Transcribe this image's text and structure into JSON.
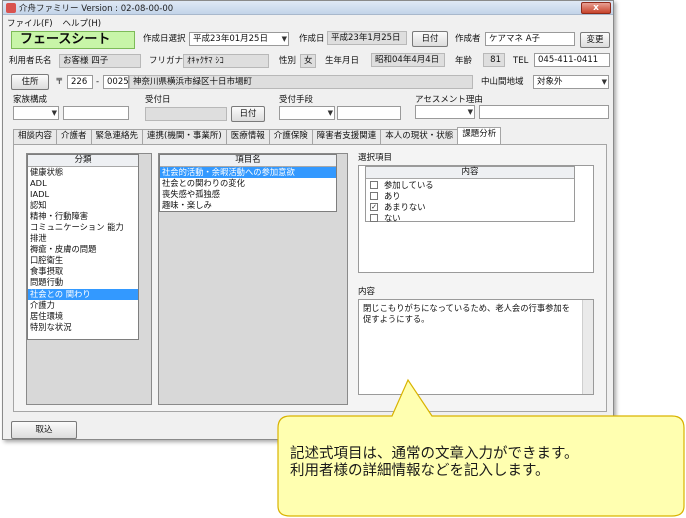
{
  "window": {
    "title": "介舟ファミリー Version : 02-08-00-00",
    "close_label": "x"
  },
  "menu": [
    "ファイル(F)",
    "ヘルプ(H)"
  ],
  "header": {
    "sheet_title": "フェースシート",
    "select_date_label": "作成日選択",
    "select_date_value": "平成23年01月25日",
    "created_label": "作成日",
    "created_value": "平成23年1月25日",
    "date_button": "日付",
    "author_label": "作成者",
    "author_value": "ケアマネ A子",
    "change_button": "変更"
  },
  "user": {
    "name_label": "利用者氏名",
    "name_value": "お客様 四子",
    "furigana_label": "フリガナ",
    "furigana_value": "ｵｷｬｸｻﾏ ｼｺ",
    "sex_label": "性別",
    "sex_value": "女",
    "birth_label": "生年月日",
    "birth_value": "昭和04年4月4日",
    "age_label": "年齢",
    "age_value": "81",
    "tel_label": "TEL",
    "tel_value": "045-411-0411"
  },
  "address": {
    "button": "住所",
    "postal_mark": "〒",
    "zip1": "226",
    "dash": "-",
    "zip2": "0025",
    "value": "神奈川県横浜市緑区十日市場町",
    "region_label": "中山間地域",
    "region_value": "対象外"
  },
  "family": {
    "label": "家族構成",
    "accept_date_label": "受付日",
    "accept_date_button": "日付",
    "accept_method_label": "受付手段",
    "assessment_label": "アセスメント理由"
  },
  "tabs": [
    "相談内容",
    "介護者",
    "緊急連絡先",
    "連携(機関・事業所)",
    "医療情報",
    "介護保険",
    "障害者支援関連",
    "本人の現状・状態",
    "課題分析"
  ],
  "active_tab": "課題分析",
  "category_list": {
    "header": "分類",
    "items": [
      "健康状態",
      "ADL",
      "IADL",
      "認知",
      "精神・行動障害",
      "コミュニケーション 能力",
      "排泄",
      "褥瘡・皮膚の問題",
      "口腔衛生",
      "食事摂取",
      "問題行動",
      "社会との 関わり",
      "介護力",
      "居住環境",
      "特別な状況"
    ],
    "selected": "社会との 関わり"
  },
  "item_list": {
    "header": "項目名",
    "items": [
      "社会的活動・余暇活動への参加意欲",
      "社会との関わりの変化",
      "喪失感や孤独感",
      "趣味・楽しみ"
    ],
    "selected": "社会的活動・余暇活動への参加意欲"
  },
  "selection": {
    "label": "選択項目",
    "header": "内容",
    "options": [
      {
        "text": "参加している",
        "checked": false
      },
      {
        "text": "あり",
        "checked": false
      },
      {
        "text": "あまりない",
        "checked": true
      },
      {
        "text": "ない",
        "checked": false
      }
    ],
    "check_mark": "✓"
  },
  "content": {
    "label": "内容",
    "text_line1": "閉じこもりがちになっているため、老人会の行事参加を",
    "text_line2": "促すようにする。"
  },
  "footer": {
    "back_button": "取込"
  },
  "callout": {
    "line1": "記述式項目は、通常の文章入力ができます。",
    "line2": "利用者様の詳細情報などを記入します。",
    "fill": "#ffffb0",
    "stroke": "#d9b300"
  },
  "colors": {
    "header_green": "#c8f5a8",
    "selection_blue": "#3399ff"
  }
}
